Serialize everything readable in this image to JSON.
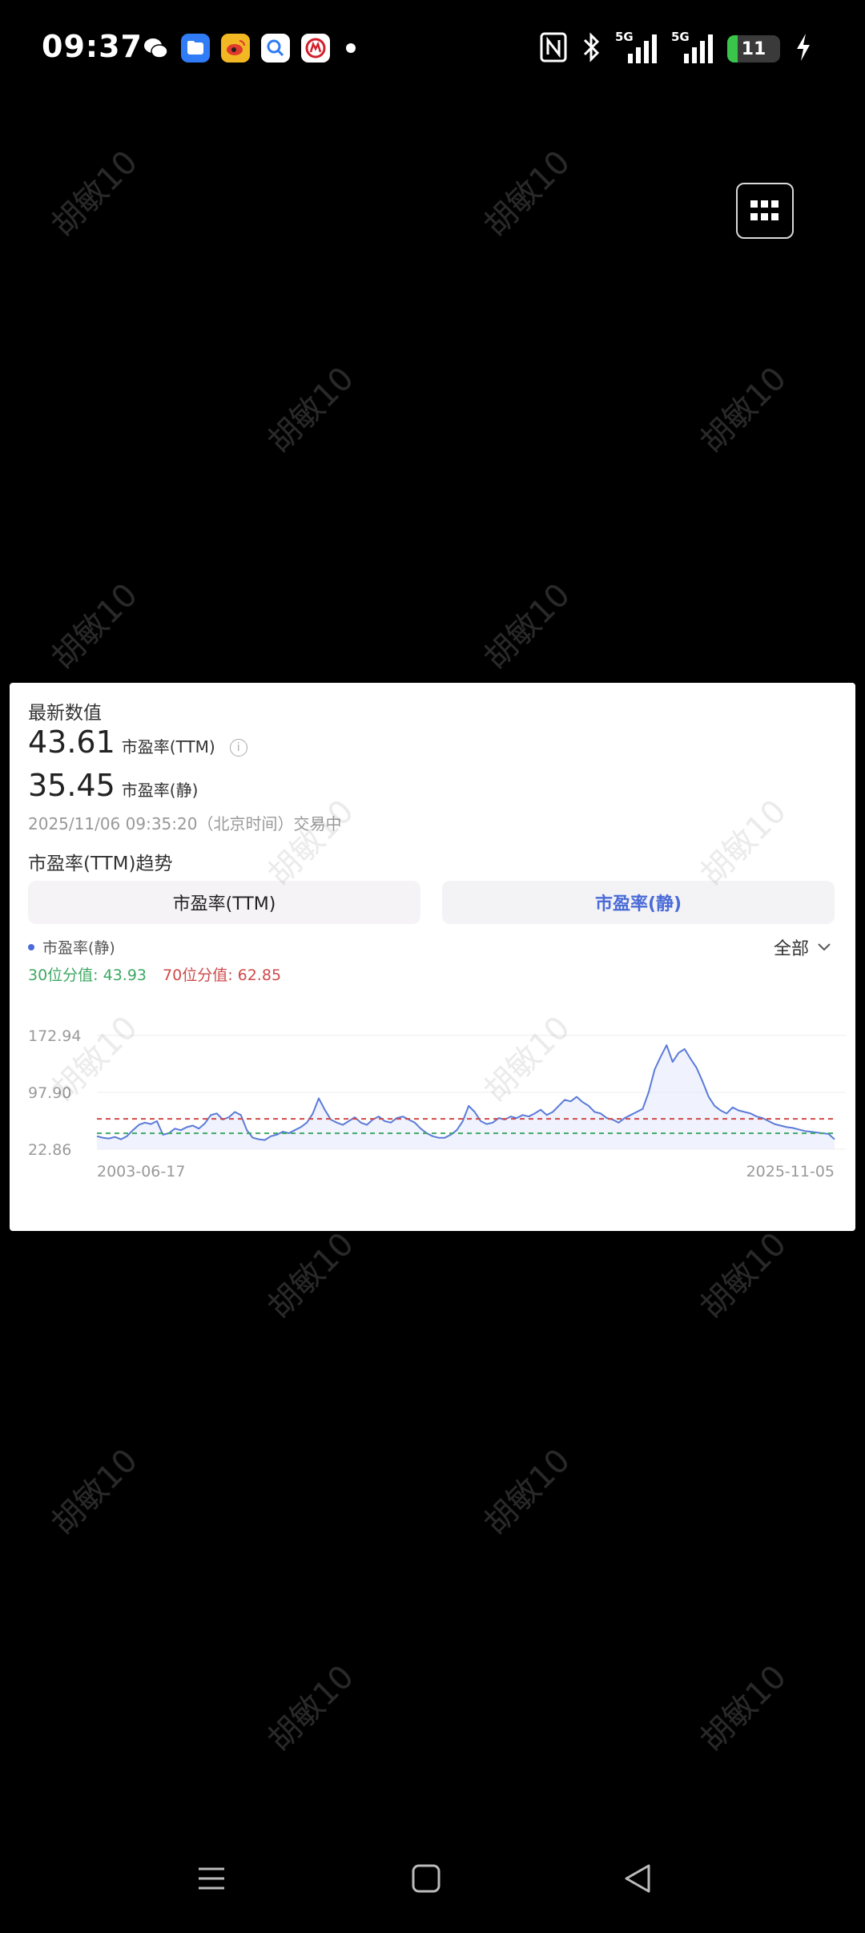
{
  "status_bar": {
    "time": "09:37",
    "signal_1": "5G",
    "signal_2": "5G",
    "battery_level": "11"
  },
  "watermark": "胡敏10",
  "panel": {
    "title": "最新数值",
    "ttm_value": "43.61",
    "ttm_label": "市盈率(TTM)",
    "static_value": "35.45",
    "static_label": "市盈率(静)",
    "updated": "2025/11/06 09:35:20（北京时间）交易中",
    "trend_title": "市盈率(TTM)趋势",
    "tabs": [
      {
        "label": "市盈率(TTM)",
        "active": false
      },
      {
        "label": "市盈率(静)",
        "active": true
      }
    ],
    "legend_label": "市盈率(静)",
    "range_label": "全部",
    "p30_text": "30位分值: 43.93",
    "p70_text": "70位分值: 62.85"
  },
  "chart_data": {
    "type": "line",
    "series": [
      {
        "name": "市盈率(静)",
        "values": [
          40,
          38,
          37,
          39,
          36,
          40,
          48,
          55,
          58,
          56,
          60,
          42,
          44,
          50,
          48,
          52,
          54,
          50,
          57,
          68,
          70,
          62,
          65,
          72,
          68,
          48,
          38,
          36,
          35,
          40,
          42,
          46,
          44,
          48,
          52,
          58,
          70,
          90,
          75,
          62,
          58,
          55,
          60,
          65,
          58,
          55,
          62,
          66,
          60,
          58,
          64,
          66,
          62,
          58,
          50,
          44,
          40,
          38,
          38,
          42,
          48,
          60,
          80,
          72,
          60,
          56,
          58,
          64,
          62,
          66,
          64,
          68,
          66,
          70,
          75,
          68,
          72,
          80,
          88,
          86,
          92,
          85,
          80,
          72,
          70,
          64,
          62,
          58,
          64,
          68,
          72,
          76,
          98,
          128,
          145,
          160,
          138,
          150,
          155,
          142,
          130,
          112,
          92,
          80,
          74,
          70,
          78,
          74,
          72,
          70,
          66,
          64,
          60,
          56,
          54,
          52,
          51,
          49,
          47,
          46,
          45,
          44,
          43,
          36
        ]
      }
    ],
    "x_start_label": "2003-06-17",
    "x_end_label": "2025-11-05",
    "y_ticks": [
      172.94,
      97.9,
      22.86
    ],
    "y_tick_labels": [
      "172.94",
      "97.90",
      "22.86"
    ],
    "ylim": [
      22.86,
      172.94
    ],
    "percentile_30": 43.93,
    "percentile_70": 62.85,
    "colors": {
      "line": "#5a7bd8",
      "area": "#e6eafb",
      "p30": "#3ea863",
      "p70": "#d04a4a",
      "grid": "#eeeeee",
      "axis_text": "#999999"
    }
  },
  "nav_bar": {
    "icons": [
      "menu-icon",
      "home-icon",
      "back-icon"
    ]
  }
}
